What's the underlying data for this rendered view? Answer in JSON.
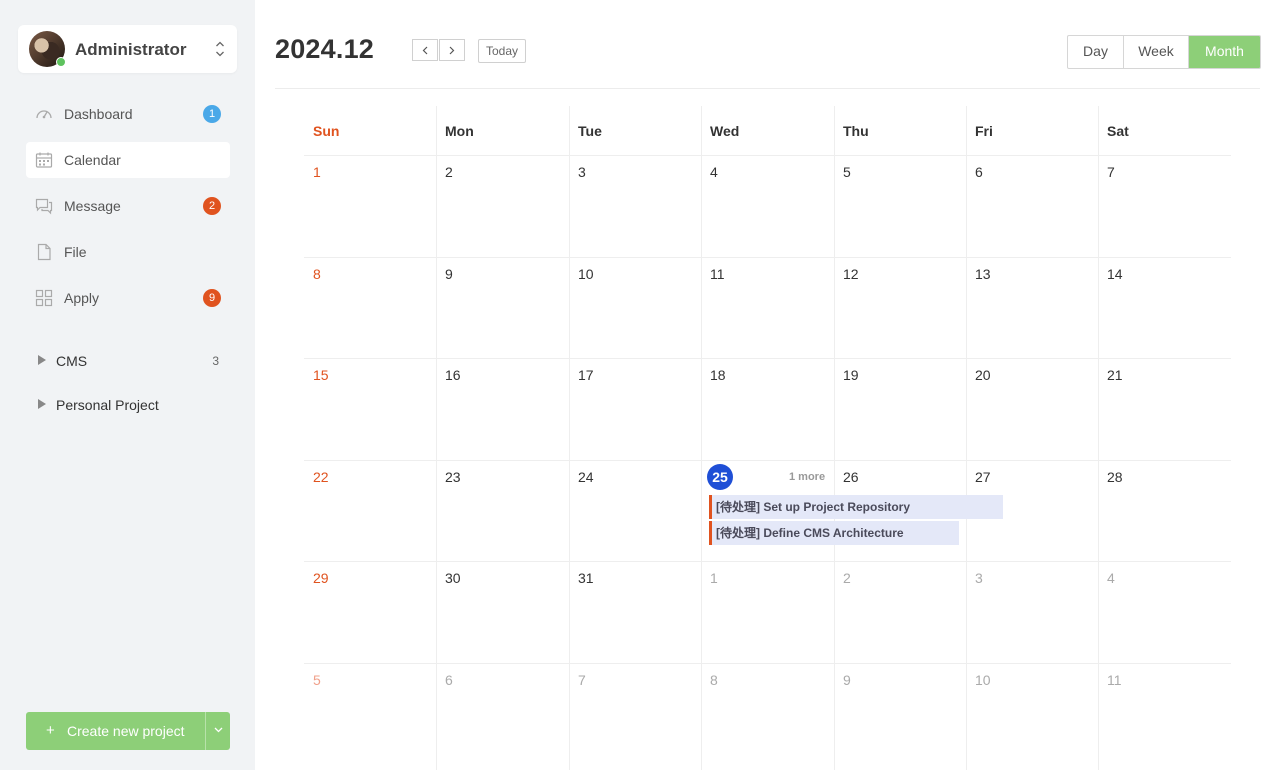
{
  "sidebar": {
    "user_name": "Administrator",
    "nav": [
      {
        "label": "Dashboard",
        "icon": "dashboard-icon",
        "badge": "1",
        "badge_color": "#4aa8e8"
      },
      {
        "label": "Calendar",
        "icon": "calendar-icon",
        "badge": "",
        "badge_color": ""
      },
      {
        "label": "Message",
        "icon": "message-icon",
        "badge": "2",
        "badge_color": "#e0531f"
      },
      {
        "label": "File",
        "icon": "file-icon",
        "badge": "",
        "badge_color": ""
      },
      {
        "label": "Apply",
        "icon": "apps-icon",
        "badge": "9",
        "badge_color": "#e0531f"
      }
    ],
    "groups": [
      {
        "label": "CMS",
        "count": "3"
      },
      {
        "label": "Personal Project",
        "count": ""
      }
    ],
    "create_label": "Create new project",
    "create_plus": "+"
  },
  "header": {
    "month_title": "2024.12",
    "today_label": "Today",
    "views": [
      "Day",
      "Week",
      "Month"
    ],
    "active_view": "Month"
  },
  "calendar": {
    "weekdays": [
      "Sun",
      "Mon",
      "Tue",
      "Wed",
      "Thu",
      "Fri",
      "Sat"
    ],
    "weeks": [
      [
        "1",
        "2",
        "3",
        "4",
        "5",
        "6",
        "7"
      ],
      [
        "8",
        "9",
        "10",
        "11",
        "12",
        "13",
        "14"
      ],
      [
        "15",
        "16",
        "17",
        "18",
        "19",
        "20",
        "21"
      ],
      [
        "22",
        "23",
        "24",
        "25",
        "26",
        "27",
        "28"
      ],
      [
        "29",
        "30",
        "31",
        "1",
        "2",
        "3",
        "4"
      ],
      [
        "5",
        "6",
        "7",
        "8",
        "9",
        "10",
        "11"
      ]
    ],
    "today": "25",
    "more_label": "1 more",
    "events": [
      {
        "title": "[待处理] Set up Project Repository"
      },
      {
        "title": "[待处理] Define CMS Architecture"
      }
    ],
    "colors": {
      "weekend": "#e0531f",
      "outside_month": "#aaaaaa",
      "today": "#1f4fd6",
      "event_bg": "#e4e8f8",
      "event_accent": "#e0531f"
    }
  }
}
